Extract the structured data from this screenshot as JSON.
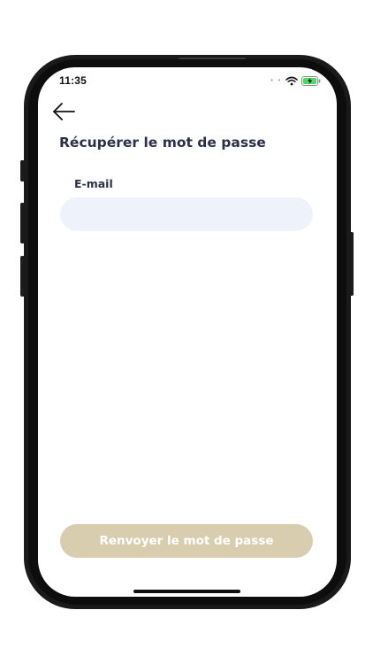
{
  "status_bar": {
    "time": "11:35",
    "signal_dots": "• •",
    "wifi_icon": "wifi-icon",
    "battery_icon": "battery-charging-icon",
    "battery_color": "#4cd964"
  },
  "header": {
    "back_icon": "arrow-left-icon",
    "title": "Récupérer le mot de passe"
  },
  "form": {
    "email_label": "E-mail",
    "email_value": "",
    "email_placeholder": ""
  },
  "actions": {
    "submit_label": "Renvoyer le mot de passe",
    "submit_color": "#d9cdb0"
  },
  "theme": {
    "text_color": "#2c2f4a",
    "input_background": "#eef3fb"
  }
}
